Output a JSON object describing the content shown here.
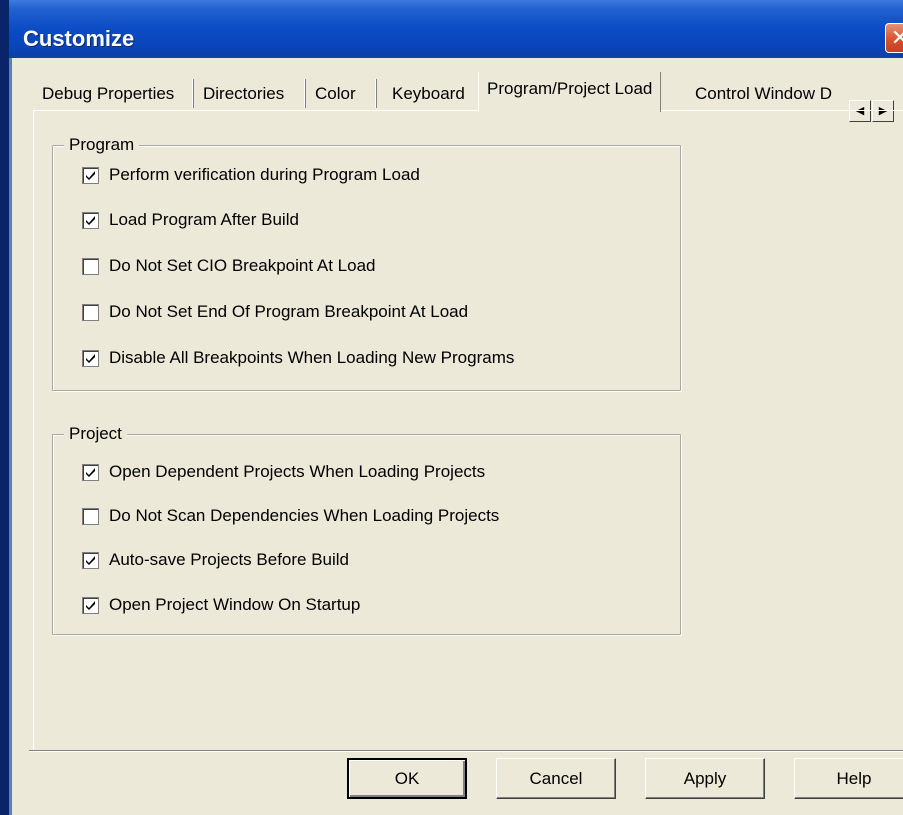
{
  "window": {
    "title": "Customize",
    "close_glyph": "✕"
  },
  "tabs": [
    {
      "label": "Debug Properties",
      "active": false
    },
    {
      "label": "Directories",
      "active": false
    },
    {
      "label": "Color",
      "active": false
    },
    {
      "label": "Keyboard",
      "active": false
    },
    {
      "label": "Program/Project Load",
      "active": true
    },
    {
      "label": "Control Window D",
      "active": false
    }
  ],
  "tab_scroll": {
    "left_glyph": "◀",
    "right_glyph": "▶"
  },
  "program_group": {
    "legend": "Program",
    "options": [
      {
        "label": "Perform verification during Program Load",
        "checked": true
      },
      {
        "label": "Load Program After Build",
        "checked": true
      },
      {
        "label": "Do Not Set CIO Breakpoint At Load",
        "checked": false
      },
      {
        "label": "Do Not Set End Of Program Breakpoint At Load",
        "checked": false
      },
      {
        "label": "Disable All Breakpoints When Loading New Programs",
        "checked": true
      }
    ]
  },
  "project_group": {
    "legend": "Project",
    "options": [
      {
        "label": "Open Dependent Projects When Loading Projects",
        "checked": true
      },
      {
        "label": "Do Not Scan Dependencies When Loading Projects",
        "checked": false
      },
      {
        "label": "Auto-save Projects Before Build",
        "checked": true
      },
      {
        "label": "Open Project Window On Startup",
        "checked": true
      }
    ]
  },
  "buttons": {
    "ok": "OK",
    "cancel": "Cancel",
    "apply": "Apply",
    "help": "Help"
  }
}
